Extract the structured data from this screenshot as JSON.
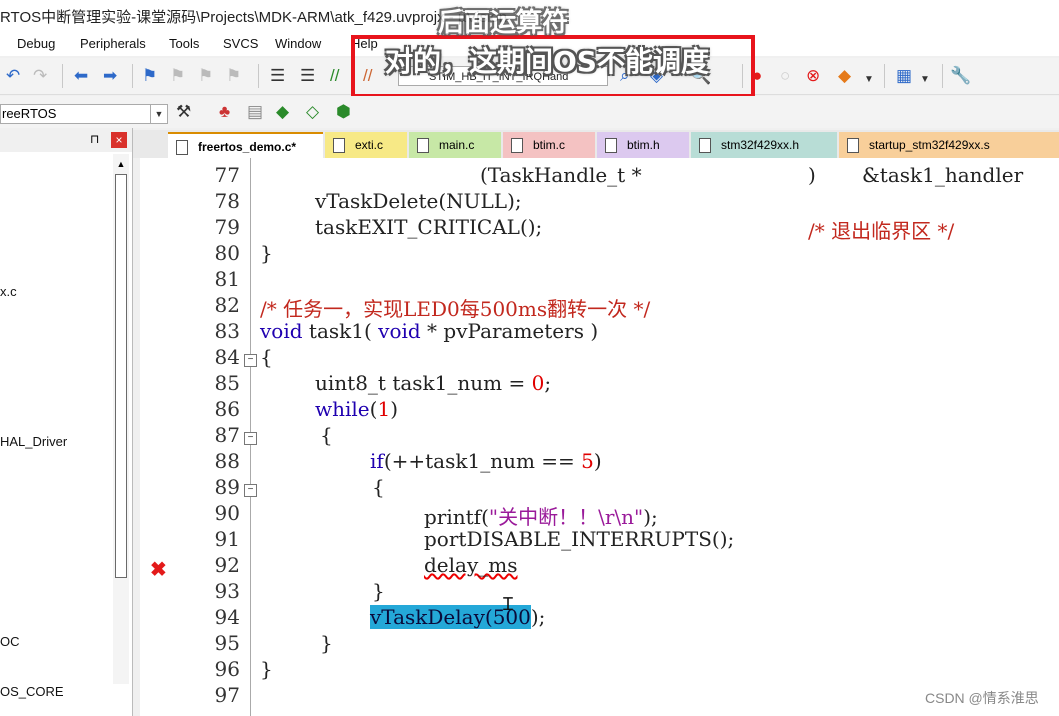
{
  "window": {
    "title": "RTOS中断管理实验-课堂源码\\Projects\\MDK-ARM\\atk_f429.uvprojx - µVision"
  },
  "overlay_captions": {
    "top": "后面运算符",
    "main": "对的，这期间OS不能调度"
  },
  "menu": [
    "Debug",
    "Peripherals",
    "Tools",
    "SVCS",
    "Window",
    "Help"
  ],
  "toolbar": {
    "find_combo_value": "STIM_HB_IT_INT_IRQHand",
    "colors": {
      "highlight_box": "#e8141c"
    }
  },
  "target": {
    "selected": "reeRTOS"
  },
  "panel": {
    "pin_icon": "⊓",
    "close_icon": "×",
    "items": [
      "x.c",
      "HAL_Driver",
      "OC",
      "OS_CORE"
    ]
  },
  "tabs": [
    {
      "label": "freertos_demo.c*",
      "active": true,
      "color": "#ffffff"
    },
    {
      "label": "exti.c",
      "active": false,
      "color": "#f7e986"
    },
    {
      "label": "main.c",
      "active": false,
      "color": "#c7e8a6"
    },
    {
      "label": "btim.c",
      "active": false,
      "color": "#f4c2c2"
    },
    {
      "label": "btim.h",
      "active": false,
      "color": "#dcc9ef"
    },
    {
      "label": "stm32f429xx.h",
      "active": false,
      "color": "#b8ddd6"
    },
    {
      "label": "startup_stm32f429xx.s",
      "active": false,
      "color": "#f8cf9a"
    }
  ],
  "code": {
    "line_numbers": [
      "77",
      "78",
      "79",
      "80",
      "81",
      "82",
      "83",
      "84",
      "85",
      "86",
      "87",
      "88",
      "89",
      "90",
      "91",
      "92",
      "93",
      "94",
      "95",
      "96",
      "97"
    ],
    "lines": {
      "l77a": "(TaskHandle_t *",
      "l77b": ")",
      "l77c": "&task1_handler",
      "l78": "vTaskDelete(NULL);",
      "l79a": "taskEXIT_CRITICAL();",
      "l79b": "/* 退出临界区 */",
      "l80": "}",
      "l82": "/* 任务一，实现LED0每500ms翻转一次 */",
      "l83a": "void",
      "l83b": " task1( ",
      "l83c": "void",
      "l83d": " * pvParameters )",
      "l84": "{",
      "l85a": "uint8_t task1_num = ",
      "l85b": "0",
      "l85c": ";",
      "l86a": "while",
      "l86b": "(",
      "l86c": "1",
      "l86d": ")",
      "l87": "{",
      "l88a": "if",
      "l88b": "(++task1_num == ",
      "l88c": "5",
      "l88d": ")",
      "l89": "{",
      "l90a": "printf(",
      "l90b": "\"关中断！！\\r\\n\"",
      "l90c": ");",
      "l91": "portDISABLE_INTERRUPTS();",
      "l92": "delay_ms",
      "l93": "}",
      "l94a": "vTaskDelay(",
      "l94b": "500",
      "l94c": ");",
      "l95": "}",
      "l96": "}"
    },
    "error_marker_line": "92",
    "error_icon": "✖"
  },
  "watermark": "CSDN @情系淮思"
}
